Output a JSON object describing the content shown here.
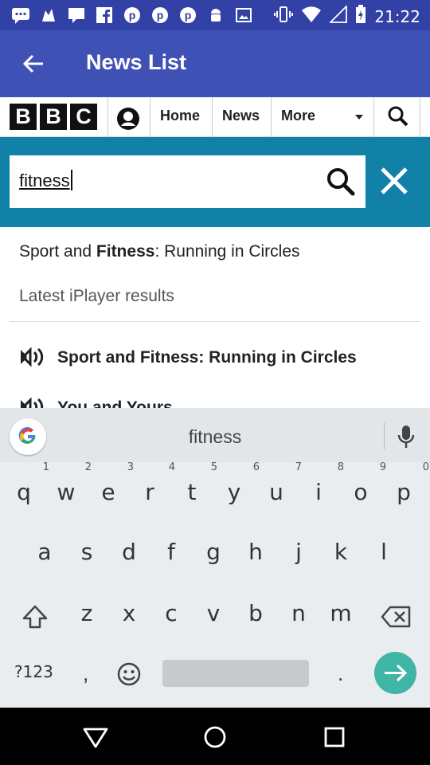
{
  "status_bar": {
    "time": "21:22",
    "icons": [
      "messages-icon",
      "notification-icon",
      "chat-icon",
      "facebook-icon",
      "pinterest-icon",
      "pinterest-icon",
      "pinterest-icon",
      "android-icon",
      "image-icon",
      "vibrate-icon",
      "wifi-icon",
      "signal-icon",
      "battery-icon"
    ]
  },
  "app_bar": {
    "title": "News List",
    "back_icon": "arrow-back-icon"
  },
  "bbc_bar": {
    "logo_letters": [
      "B",
      "B",
      "C"
    ],
    "nav": [
      "Home",
      "News",
      "More"
    ]
  },
  "search": {
    "value": "fitness"
  },
  "results": {
    "suggestion_prefix": "Sport and ",
    "suggestion_bold": "Fitness",
    "suggestion_suffix": ": Running in Circles",
    "section_label": "Latest iPlayer results",
    "items": [
      "Sport and Fitness: Running in Circles",
      "You and Yours"
    ]
  },
  "keyboard": {
    "suggestion": "fitness",
    "row1": [
      "q",
      "w",
      "e",
      "r",
      "t",
      "y",
      "u",
      "i",
      "o",
      "p"
    ],
    "row1_hints": [
      "1",
      "2",
      "3",
      "4",
      "5",
      "6",
      "7",
      "8",
      "9",
      "0"
    ],
    "row2": [
      "a",
      "s",
      "d",
      "f",
      "g",
      "h",
      "j",
      "k",
      "l"
    ],
    "row3": [
      "z",
      "x",
      "c",
      "v",
      "b",
      "n",
      "m"
    ],
    "symbols_label": "?123",
    "comma": ",",
    "period": "."
  },
  "colors": {
    "status_bar": "#3141a6",
    "app_bar": "#3f51b5",
    "search_panel": "#1181a8",
    "enter_key": "#3fb5a6"
  }
}
